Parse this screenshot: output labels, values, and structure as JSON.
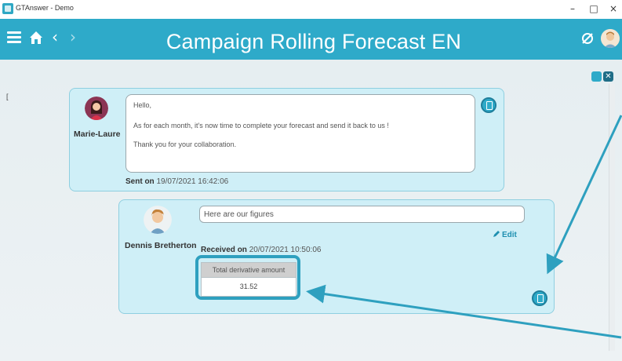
{
  "window": {
    "app_title": "GTAnswer - Demo",
    "minimize": "–",
    "maximize": "□",
    "close": "×"
  },
  "header": {
    "title": "Campaign Rolling Forecast EN",
    "icons": [
      "hamburger-icon",
      "home-icon",
      "back-arrow-icon",
      "forward-arrow-icon",
      "sync-icon",
      "user-avatar"
    ],
    "back_arrow": "‹",
    "forward_arrow": "›",
    "accent_color": "#2eaac9"
  },
  "left_marker": "[",
  "thread_toolbar": {
    "icons": [
      "alarm-icon",
      "close-icon"
    ],
    "close_glyph": "✕"
  },
  "messages": [
    {
      "sender": "Marie-Laure",
      "lines": [
        "Hello,",
        "As for each month, it's now time to complete your forecast and send it back to us !",
        "Thank you for your collaboration."
      ],
      "meta_label": "Sent on",
      "meta_value": "19/07/2021 16:42:06"
    },
    {
      "sender": "Dennis Bretherton",
      "reply_value": "Here are our figures",
      "edit_label": "Edit",
      "meta_label": "Received on",
      "meta_value": "20/07/2021 10:50:06",
      "table": {
        "header": "Total derivative amount",
        "value": "31.52"
      }
    }
  ],
  "annotation_color": "#2ea0bf"
}
